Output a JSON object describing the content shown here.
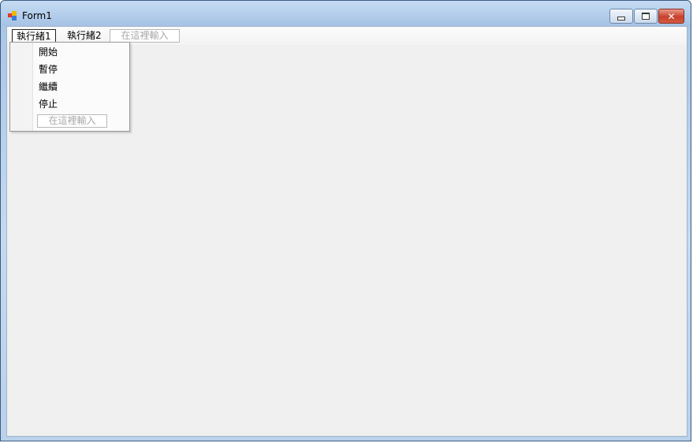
{
  "window": {
    "title": "Form1",
    "controls": {
      "minimize_icon": "minimize-icon",
      "maximize_icon": "maximize-icon",
      "close_icon": "close-icon"
    }
  },
  "menubar": {
    "items": [
      {
        "label": "執行緒1",
        "active": true
      },
      {
        "label": "執行緒2",
        "active": false
      }
    ],
    "type_here": "在這裡輸入"
  },
  "dropdown": {
    "items": [
      {
        "label": "開始"
      },
      {
        "label": "暫停"
      },
      {
        "label": "繼續"
      },
      {
        "label": "停止"
      }
    ],
    "type_here": "在這裡輸入"
  },
  "colors": {
    "client_bg": "#f0f0f0",
    "title_gradient_top": "#c5dbf2",
    "close_button": "#c6412c"
  }
}
